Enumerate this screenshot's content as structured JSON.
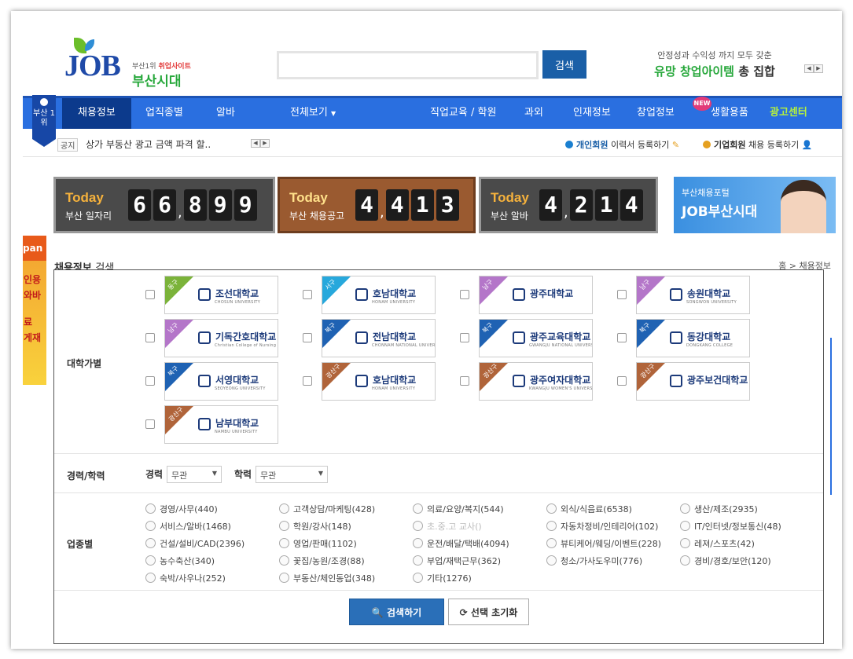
{
  "header": {
    "logo_job": "JOB",
    "logo_sub_prefix": "부산1위",
    "logo_sub_red": "취업사이트",
    "logo_sub_main": "부산시대",
    "search_button": "검색",
    "ad_line1": "안정성과 수익성 까지 모두 갖춘",
    "ad_line2_green": "유망 창업아이템",
    "ad_line2_dark": "총 집합"
  },
  "nav": {
    "badge": "부산 1위",
    "items": [
      "채용정보",
      "업직종별",
      "알바",
      "전체보기",
      "직업교육 / 학원",
      "과외",
      "인재정보",
      "창업정보",
      "생활용품",
      "광고센터"
    ],
    "new_badge": "NEW"
  },
  "notice": {
    "tag": "공지",
    "text": "상가 부동산 광고 금액 파격 할..",
    "personal_bold": "개인회원",
    "personal_rest": "이력서 등록하기",
    "company_bold": "기업회원",
    "company_rest": "채용 등록하기"
  },
  "counters": [
    {
      "today": "Today",
      "label": "부산 일자리",
      "value": "66,899"
    },
    {
      "today": "Today",
      "label": "부산 채용공고",
      "value": "4,413"
    },
    {
      "today": "Today",
      "label": "부산 알바",
      "value": "4,214"
    }
  ],
  "banner": {
    "line1": "부산채용포털",
    "line2": "JOB부산시대"
  },
  "side_ad": [
    "pan",
    "인용",
    "와바",
    "료",
    "게재"
  ],
  "search": {
    "title_bold": "채용정보",
    "title_rest": "검색",
    "breadcrumb": "홈 > 채용정보",
    "univ_label": "대학가별",
    "universities": [
      {
        "district": "동구",
        "name": "조선대학교",
        "en": "CHOSUN UNIVERSITY",
        "color": "#7bb33a"
      },
      {
        "district": "서구",
        "name": "호남대학교",
        "en": "HONAM UNIVERSITY",
        "color": "#27a8dc"
      },
      {
        "district": "남구",
        "name": "광주대학교",
        "en": "",
        "color": "#b476c9"
      },
      {
        "district": "남구",
        "name": "송원대학교",
        "en": "SONGWON UNIVERSITY",
        "color": "#b476c9"
      },
      {
        "district": "남구",
        "name": "기독간호대학교",
        "en": "Christian College of Nursing",
        "color": "#b476c9"
      },
      {
        "district": "북구",
        "name": "전남대학교",
        "en": "CHONNAM NATIONAL UNIVERSITY",
        "color": "#1f62b3"
      },
      {
        "district": "북구",
        "name": "광주교육대학교",
        "en": "GWANGJU NATIONAL UNIVERSITY OF EDUCATION",
        "color": "#1f62b3"
      },
      {
        "district": "북구",
        "name": "동강대학교",
        "en": "DONGKANG COLLEGE",
        "color": "#1f62b3"
      },
      {
        "district": "북구",
        "name": "서영대학교",
        "en": "SEOYEONG UNIVERSITY",
        "color": "#1f62b3"
      },
      {
        "district": "광산구",
        "name": "호남대학교",
        "en": "HONAM UNIVERSITY",
        "color": "#b0643a"
      },
      {
        "district": "광산구",
        "name": "광주여자대학교",
        "en": "KWANGJU WOMEN'S UNIVERSITY",
        "color": "#b0643a"
      },
      {
        "district": "광산구",
        "name": "광주보건대학교",
        "en": "",
        "color": "#b0643a"
      },
      {
        "district": "광산구",
        "name": "남부대학교",
        "en": "NAMBU UNIVERSITY",
        "color": "#b0643a"
      }
    ],
    "career_label": "경력/학력",
    "career": {
      "label": "경력",
      "value": "무관"
    },
    "education": {
      "label": "학력",
      "value": "무관"
    },
    "industry_label": "업종별",
    "industries": [
      [
        "경영/사무(440)",
        "고객상담/마케팅(428)",
        "의료/요양/복지(544)",
        "외식/식음료(6538)",
        "생산/제조(2935)"
      ],
      [
        "서비스/알바(1468)",
        "학원/강사(148)",
        "초.중.고 교사()",
        "자동차정비/인테리어(102)",
        "IT/인터넷/정보통신(48)"
      ],
      [
        "건설/설비/CAD(2396)",
        "영업/판매(1102)",
        "운전/배달/택배(4094)",
        "뷰티케어/웨딩/이벤트(228)",
        "레져/스포츠(42)"
      ],
      [
        "농수축산(340)",
        "꽃집/농원/조경(88)",
        "부업/재택근무(362)",
        "청소/가사도우미(776)",
        "경비/경호/보안(120)"
      ],
      [
        "숙박/사우나(252)",
        "부동산/체인동업(348)",
        "기타(1276)"
      ]
    ],
    "search_btn": "검색하기",
    "reset_btn": "선택 초기화"
  }
}
